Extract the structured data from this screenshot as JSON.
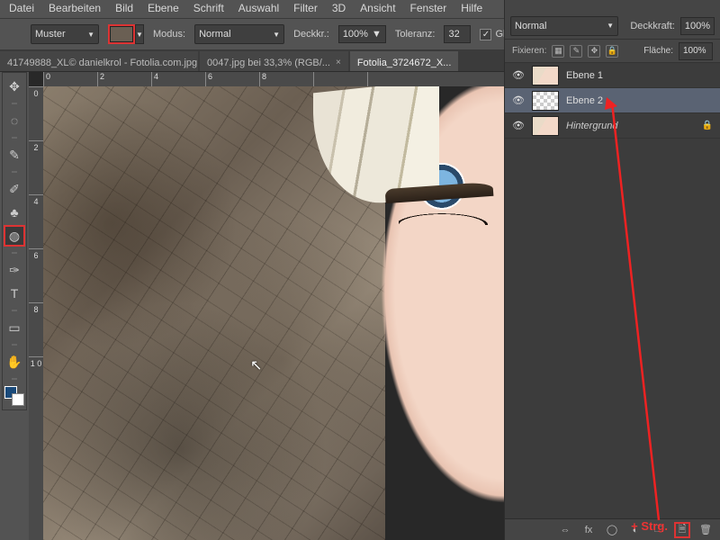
{
  "menu": {
    "items": [
      "Datei",
      "Bearbeiten",
      "Bild",
      "Ebene",
      "Schrift",
      "Auswahl",
      "Filter",
      "3D",
      "Ansicht",
      "Fenster",
      "Hilfe"
    ]
  },
  "options": {
    "fill_label": "Muster",
    "mode_label": "Modus:",
    "mode_value": "Normal",
    "opacity_label": "Deckkr.:",
    "opacity_value": "100%",
    "tolerance_label": "Toleranz:",
    "tolerance_value": "32",
    "antialias_label": "Glätt"
  },
  "tabs": [
    {
      "label": "41749888_XL© danielkrol - Fotolia.com.jpg"
    },
    {
      "label": "0047.jpg bei 33,3% (RGB/..."
    },
    {
      "label": "Fotolia_3724672_X..."
    }
  ],
  "ruler_h": [
    "0",
    "2",
    "4",
    "6",
    "8"
  ],
  "ruler_v": [
    "0",
    "2",
    "4",
    "6",
    "8",
    "1  0"
  ],
  "panel": {
    "blend_mode": "Normal",
    "opacity_label": "Deckkraft:",
    "opacity_value": "100%",
    "fill_label": "Fläche:",
    "fill_value": "100%",
    "lock_label": "Fixieren:"
  },
  "layers": [
    {
      "name": "Ebene 1",
      "thumb": "face",
      "locked": false
    },
    {
      "name": "Ebene 2",
      "thumb": "checker",
      "locked": false,
      "selected": true
    },
    {
      "name": "Hintergrund",
      "thumb": "face",
      "locked": true,
      "italic": true
    }
  ],
  "annotation": {
    "shortcut": "+ Strg."
  }
}
